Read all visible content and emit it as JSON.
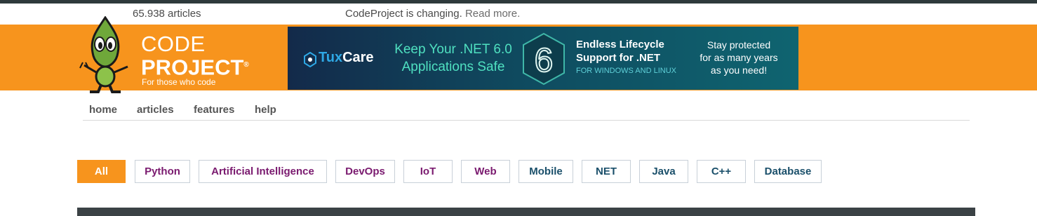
{
  "info": {
    "article_count": "65.938 articles",
    "notice_text": "CodeProject is changing.",
    "notice_link": "Read more."
  },
  "brand": {
    "line1": "CODE",
    "line2": "PROJECT",
    "reg": "®",
    "tagline": "For those who code"
  },
  "banner": {
    "company_a": "Tux",
    "company_b": "Care",
    "keep_line1": "Keep Your .NET 6.0",
    "keep_line2": "Applications Safe",
    "digit": "6",
    "endless_line1": "Endless Lifecycle",
    "endless_line2": "Support for .NET",
    "endless_sub": "FOR WINDOWS AND LINUX",
    "stay_line1": "Stay protected",
    "stay_line2": "for as many years",
    "stay_line3": "as you need!"
  },
  "nav": {
    "home": "home",
    "articles": "articles",
    "features": "features",
    "help": "help"
  },
  "tags": [
    {
      "label": "All"
    },
    {
      "label": "Python"
    },
    {
      "label": "Artificial Intelligence"
    },
    {
      "label": "DevOps"
    },
    {
      "label": "IoT"
    },
    {
      "label": "Web"
    },
    {
      "label": "Mobile"
    },
    {
      "label": "NET"
    },
    {
      "label": "Java"
    },
    {
      "label": "C++"
    },
    {
      "label": "Database"
    }
  ],
  "colors": {
    "brand_orange": "#f7941d",
    "tag_purple": "#7a1a6f",
    "tag_teal": "#1a4f6a"
  },
  "icons": {
    "logo": "codeproject-bob-mascot",
    "tux_mark": "tuxcare-logo-icon"
  }
}
